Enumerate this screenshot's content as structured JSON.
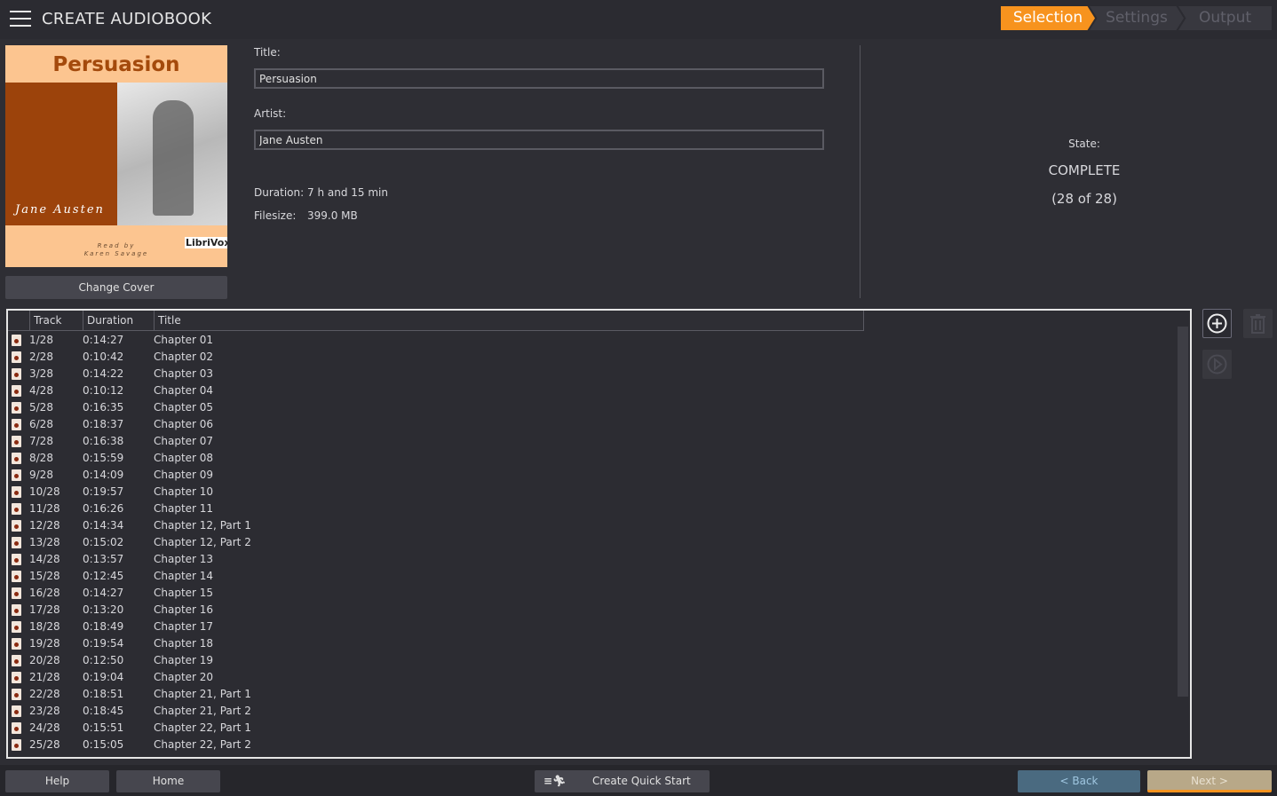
{
  "app": {
    "title": "CREATE AUDIOBOOK",
    "menu_icon": "hamburger-icon"
  },
  "steps": [
    {
      "label": "Selection",
      "active": true
    },
    {
      "label": "Settings",
      "active": false
    },
    {
      "label": "Output",
      "active": false
    }
  ],
  "cover": {
    "title": "Persuasion",
    "author": "Jane Austen",
    "read_by": "Read by",
    "reader": "Karen Savage",
    "publisher": "LibriVox",
    "change_label": "Change Cover"
  },
  "form": {
    "title_label": "Title:",
    "title_value": "Persuasion",
    "artist_label": "Artist:",
    "artist_value": "Jane Austen",
    "duration_label": "Duration:",
    "duration_value": "7 h and 15 min",
    "filesize_label": "Filesize:",
    "filesize_value": "399.0 MB"
  },
  "state": {
    "label": "State:",
    "value": "COMPLETE",
    "progress": "(28 of 28)"
  },
  "table": {
    "headers": [
      "Track",
      "Duration",
      "Title"
    ],
    "rows": [
      [
        "1/28",
        "0:14:27",
        "Chapter 01"
      ],
      [
        "2/28",
        "0:10:42",
        "Chapter 02"
      ],
      [
        "3/28",
        "0:14:22",
        "Chapter 03"
      ],
      [
        "4/28",
        "0:10:12",
        "Chapter 04"
      ],
      [
        "5/28",
        "0:16:35",
        "Chapter 05"
      ],
      [
        "6/28",
        "0:18:37",
        "Chapter 06"
      ],
      [
        "7/28",
        "0:16:38",
        "Chapter 07"
      ],
      [
        "8/28",
        "0:15:59",
        "Chapter 08"
      ],
      [
        "9/28",
        "0:14:09",
        "Chapter 09"
      ],
      [
        "10/28",
        "0:19:57",
        "Chapter 10"
      ],
      [
        "11/28",
        "0:16:26",
        "Chapter 11"
      ],
      [
        "12/28",
        "0:14:34",
        "Chapter 12, Part 1"
      ],
      [
        "13/28",
        "0:15:02",
        "Chapter 12, Part 2"
      ],
      [
        "14/28",
        "0:13:57",
        "Chapter 13"
      ],
      [
        "15/28",
        "0:12:45",
        "Chapter 14"
      ],
      [
        "16/28",
        "0:14:27",
        "Chapter 15"
      ],
      [
        "17/28",
        "0:13:20",
        "Chapter 16"
      ],
      [
        "18/28",
        "0:18:49",
        "Chapter 17"
      ],
      [
        "19/28",
        "0:19:54",
        "Chapter 18"
      ],
      [
        "20/28",
        "0:12:50",
        "Chapter 19"
      ],
      [
        "21/28",
        "0:19:04",
        "Chapter 20"
      ],
      [
        "22/28",
        "0:18:51",
        "Chapter 21, Part 1"
      ],
      [
        "23/28",
        "0:18:45",
        "Chapter 21, Part 2"
      ],
      [
        "24/28",
        "0:15:51",
        "Chapter 22, Part 1"
      ],
      [
        "25/28",
        "0:15:05",
        "Chapter 22, Part 2"
      ]
    ]
  },
  "buttons": {
    "help": "Help",
    "home": "Home",
    "quick_start": "Create Quick Start",
    "back": "< Back",
    "next": "Next >"
  },
  "colors": {
    "accent": "#f7931e",
    "background": "#2e2e34"
  }
}
